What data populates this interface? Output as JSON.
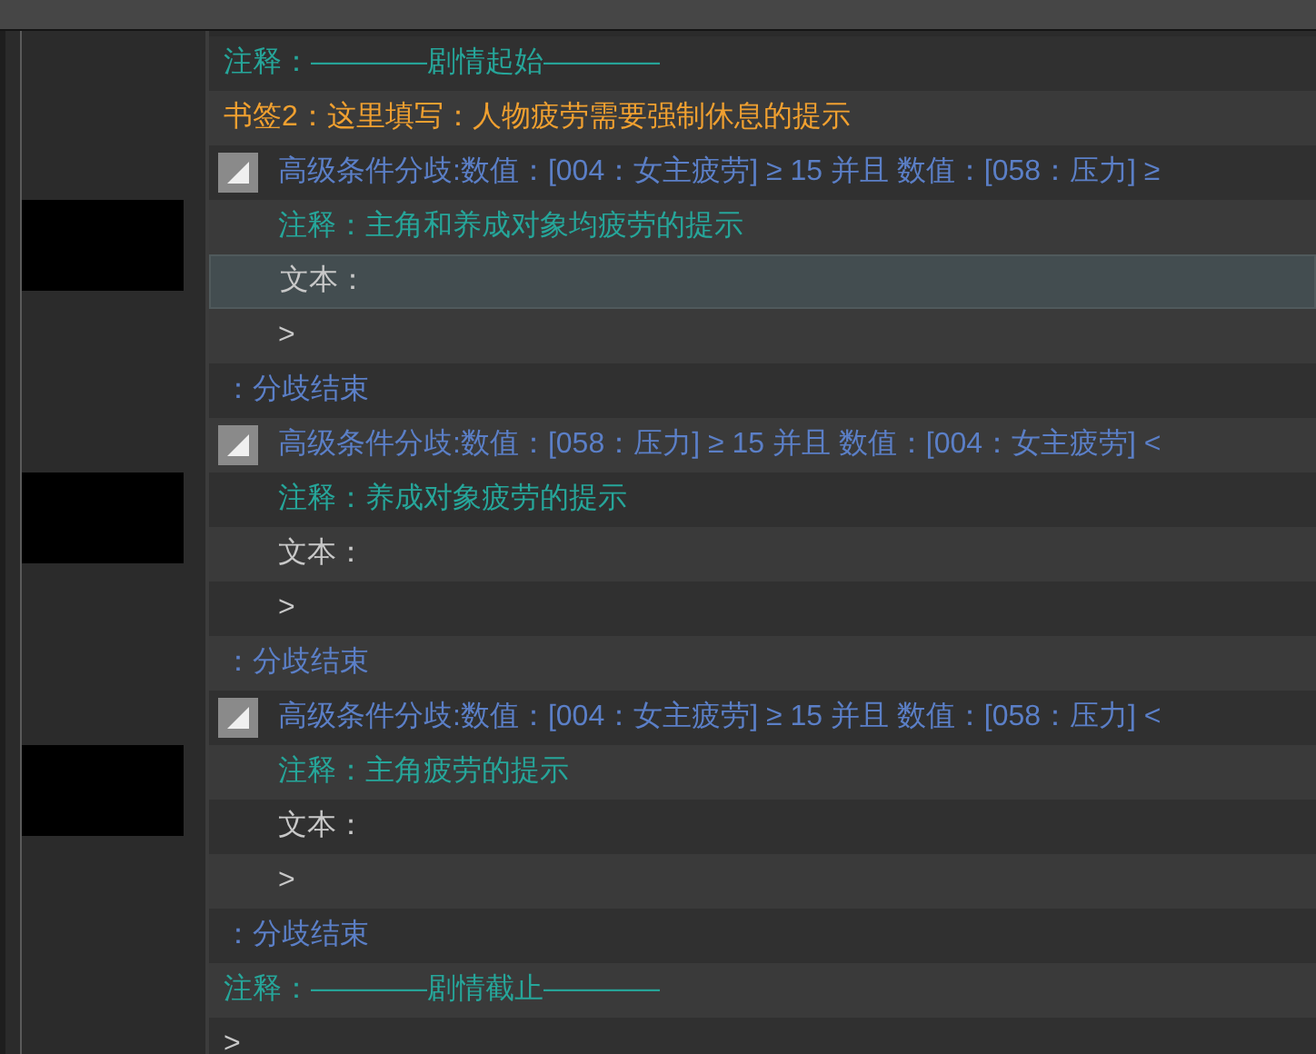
{
  "events": [
    {
      "kind": "comment",
      "label": "注释：",
      "text": "————剧情起始————",
      "selected": false
    },
    {
      "kind": "bookmark",
      "text": "书签2：这里填写：人物疲劳需要强制休息的提示",
      "selected": false
    },
    {
      "kind": "branch",
      "text": "高级条件分歧:数值：[004：女主疲劳] ≥ 15 并且  数值：[058：压力] ≥",
      "expanded": true,
      "selected": false,
      "children": [
        {
          "kind": "comment",
          "label": "注释：",
          "text": "主角和养成对象均疲劳的提示",
          "selected": false
        },
        {
          "kind": "text",
          "text": "文本：",
          "selected": true
        },
        {
          "kind": "cursor",
          "text": ">",
          "selected": false
        }
      ]
    },
    {
      "kind": "branch_end",
      "text": "：分歧结束",
      "selected": false
    },
    {
      "kind": "branch",
      "text": "高级条件分歧:数值：[058：压力] ≥ 15 并且  数值：[004：女主疲劳] <",
      "expanded": true,
      "selected": false,
      "children": [
        {
          "kind": "comment",
          "label": "注释：",
          "text": "养成对象疲劳的提示",
          "selected": false
        },
        {
          "kind": "text",
          "text": "文本：",
          "selected": false
        },
        {
          "kind": "cursor",
          "text": ">",
          "selected": false
        }
      ]
    },
    {
      "kind": "branch_end",
      "text": "：分歧结束",
      "selected": false
    },
    {
      "kind": "branch",
      "text": "高级条件分歧:数值：[004：女主疲劳] ≥ 15 并且  数值：[058：压力] <",
      "expanded": true,
      "selected": false,
      "children": [
        {
          "kind": "comment",
          "label": "注释：",
          "text": "主角疲劳的提示",
          "selected": false
        },
        {
          "kind": "text",
          "text": "文本：",
          "selected": false
        },
        {
          "kind": "cursor",
          "text": ">",
          "selected": false
        }
      ]
    },
    {
      "kind": "branch_end",
      "text": "：分歧结束",
      "selected": false
    },
    {
      "kind": "comment",
      "label": "注释：",
      "text": "————剧情截止————",
      "selected": false
    },
    {
      "kind": "cursor",
      "text": ">",
      "selected": false
    }
  ]
}
